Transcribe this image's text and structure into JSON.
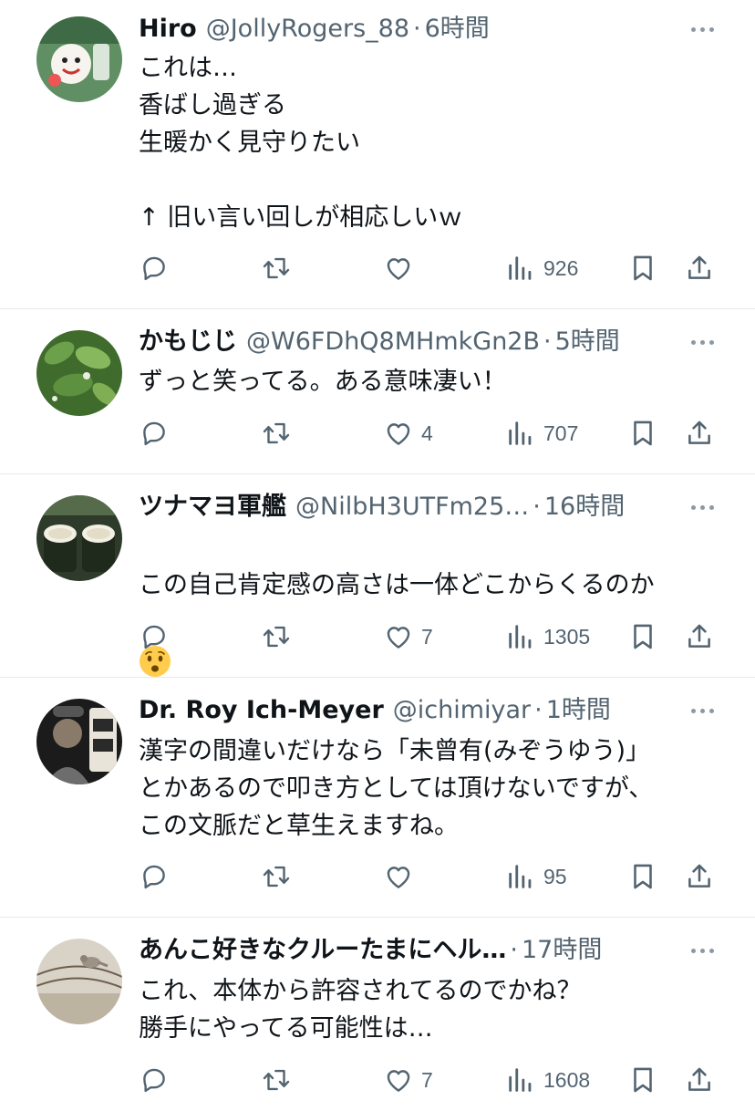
{
  "colors": {
    "text": "#0f1419",
    "secondary": "#536471",
    "icon": "#536471",
    "divider": "#e6e9ec"
  },
  "tweets": [
    {
      "name": "Hiro",
      "handle": "@JollyRogers_88",
      "time": "6時間",
      "text": "これは…\n香ばし過ぎる\n生暖かく見守りたい\n\n↑ 旧い言い回しが相応しいｗ",
      "likes": "",
      "views": "926",
      "avatar": "green-cartoon-avatar"
    },
    {
      "name": "かもじじ",
      "handle": "@W6FDhQ8MHmkGn2B",
      "time": "5時間",
      "text": "ずっと笑ってる。ある意味凄い！",
      "likes": "4",
      "views": "707",
      "avatar": "green-leaves-avatar"
    },
    {
      "name": "ツナマヨ軍艦",
      "handle": "@NilbH3UTFm25…",
      "time": "16時間",
      "text": "この自己肯定感の高さは一体どこからくるのか",
      "emoji": "worried-face-emoji",
      "likes": "7",
      "views": "1305",
      "avatar": "gunkan-sushi-avatar"
    },
    {
      "name": "Dr. Roy Ich-Meyer",
      "handle": "@ichimiyar",
      "time": "1時間",
      "text": "漢字の間違いだけなら「未曾有(みぞうゆう)」\nとかあるので叩き方としては頂けないですが、\nこの文脈だと草生えますね。",
      "likes": "",
      "views": "95",
      "avatar": "dark-photo-avatar"
    },
    {
      "name": "あんこ好きなクルーたまにヘル…",
      "handle": "",
      "time": "17時間",
      "text": "これ、本体から許容されてるのでかね？\n勝手にやってる可能性は…",
      "likes": "7",
      "views": "1608",
      "avatar": "bird-on-wire-avatar"
    }
  ]
}
